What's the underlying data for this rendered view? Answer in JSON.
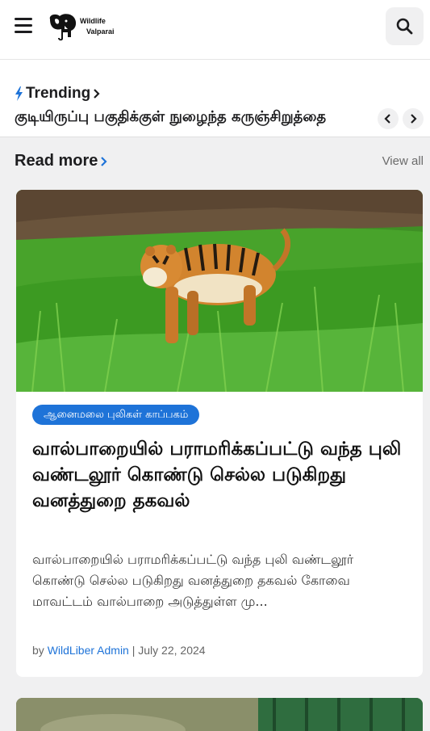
{
  "header": {
    "logo_line1": "Wildlife",
    "logo_line2": "Valparai",
    "menu_icon": "hamburger-icon",
    "search_icon": "search-icon"
  },
  "trending": {
    "title": "Trending",
    "headline": "குடியிருப்பு பகுதிக்குள் நுழைந்த கருஞ்சிறுத்தை",
    "icon": "bolt-icon",
    "accent": "#1e73d8"
  },
  "read_more": {
    "title": "Read more",
    "view_all": "View all"
  },
  "article": {
    "category": "ஆனைமலை புலிகள் காப்பகம்",
    "title": "வால்பாறையில் பராமரிக்கப்பட்டு வந்த புலி வண்டலூர் கொண்டு செல்ல படுகிறது வனத்துறை தகவல்",
    "excerpt": "வால்பாறையில் பராமரிக்கப்பட்டு வந்த புலி வண்டலூர் கொண்டு செல்ல படுகிறது வனத்துறை தகவல் கோவை மாவட்டம் வால்பாறை அடுத்துள்ள மு...",
    "by": "by",
    "author": "WildLiber Admin",
    "separator": "|",
    "date": "July 22, 2024",
    "badge_color": "#1e73d8"
  }
}
